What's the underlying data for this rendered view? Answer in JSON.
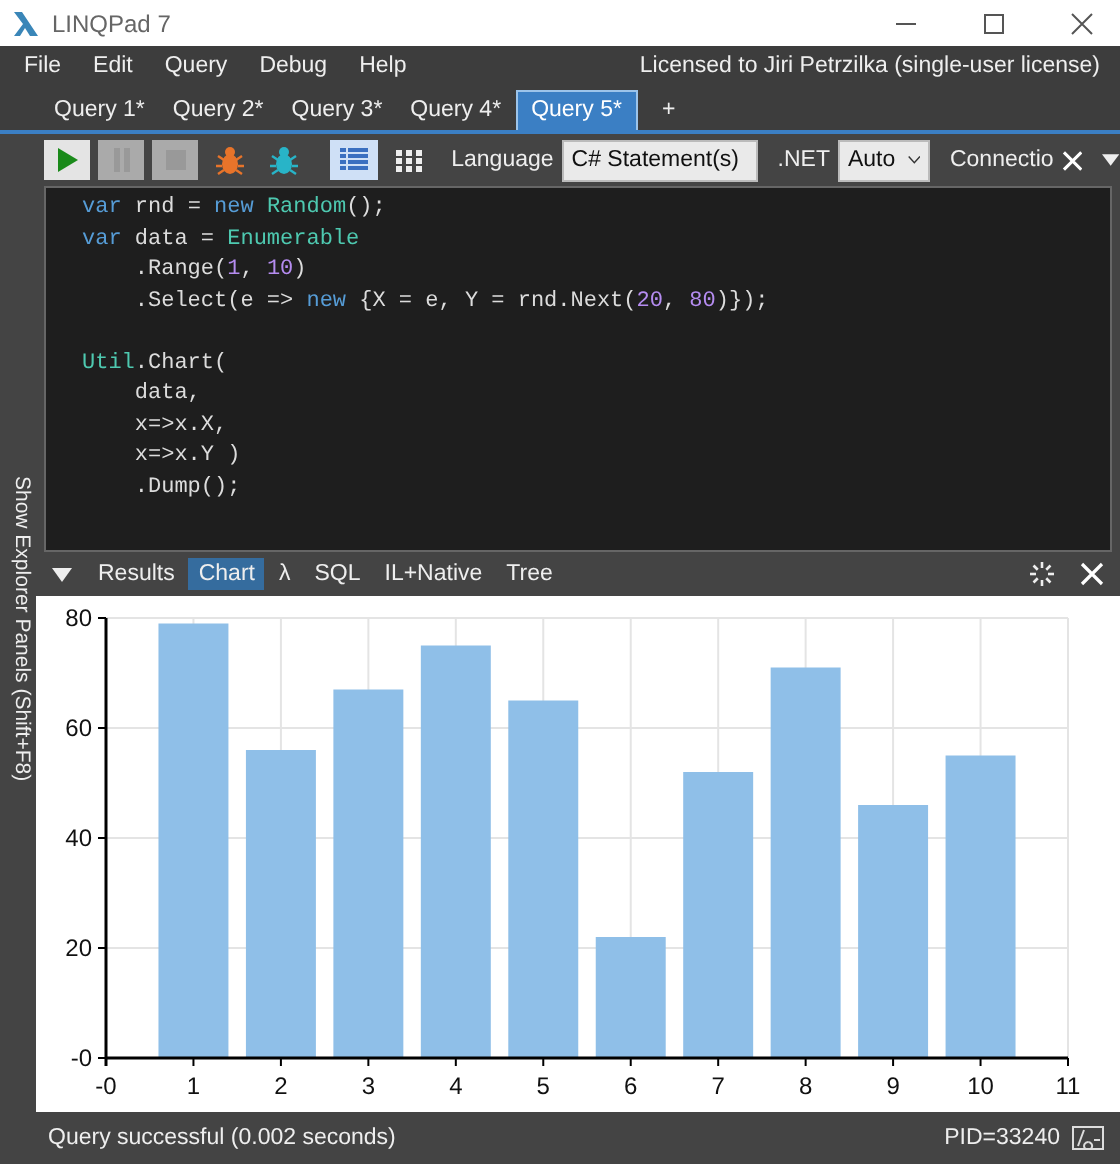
{
  "window": {
    "title": "LINQPad 7"
  },
  "menu": [
    "File",
    "Edit",
    "Query",
    "Debug",
    "Help"
  ],
  "license": "Licensed to Jiri Petrzilka (single-user license)",
  "query_tabs": [
    {
      "label": "Query 1*",
      "selected": false
    },
    {
      "label": "Query 2*",
      "selected": false
    },
    {
      "label": "Query 3*",
      "selected": false
    },
    {
      "label": "Query 4*",
      "selected": false
    },
    {
      "label": "Query 5*",
      "selected": true
    }
  ],
  "new_tab": "+",
  "toolbar": {
    "actions": [
      {
        "kind": "run",
        "disabled": false
      },
      {
        "kind": "pause",
        "disabled": true
      },
      {
        "kind": "stop",
        "disabled": true
      },
      {
        "kind": "bug",
        "disabled": false
      },
      {
        "kind": "bug-step",
        "disabled": false
      }
    ],
    "view_modes": [
      {
        "kind": "rich",
        "selected": true
      },
      {
        "kind": "grid",
        "selected": false
      }
    ],
    "language": {
      "label": "Language",
      "value": "C# Statement(s)"
    },
    "dotnet": {
      "label": ".NET",
      "value": "Auto"
    },
    "connection": {
      "label": "Connectio"
    }
  },
  "explorer_toggle": "Show Explorer Panels  (Shift+F8)",
  "editor": {
    "lines": [
      {
        "tokens": [
          {
            "kind": "kw",
            "text": "var"
          },
          {
            "kind": "plain",
            "text": " rnd = "
          },
          {
            "kind": "kw",
            "text": "new"
          },
          {
            "kind": "type",
            "text": " Random"
          },
          {
            "kind": "plain",
            "text": "();"
          }
        ]
      },
      {
        "tokens": [
          {
            "kind": "kw",
            "text": "var"
          },
          {
            "kind": "plain",
            "text": " data = "
          },
          {
            "kind": "type",
            "text": "Enumerable"
          }
        ]
      },
      {
        "tokens": [
          {
            "kind": "plain",
            "text": "    .Range("
          },
          {
            "kind": "num",
            "text": "1"
          },
          {
            "kind": "plain",
            "text": ", "
          },
          {
            "kind": "num",
            "text": "10"
          },
          {
            "kind": "plain",
            "text": ")"
          }
        ]
      },
      {
        "tokens": [
          {
            "kind": "plain",
            "text": "    .Select(e => "
          },
          {
            "kind": "kw",
            "text": "new"
          },
          {
            "kind": "plain",
            "text": " {X = e, Y = rnd.Next("
          },
          {
            "kind": "num",
            "text": "20"
          },
          {
            "kind": "plain",
            "text": ", "
          },
          {
            "kind": "num",
            "text": "80"
          },
          {
            "kind": "plain",
            "text": ")});"
          }
        ]
      },
      {
        "gap_before": true,
        "tokens": [
          {
            "kind": "type",
            "text": "Util"
          },
          {
            "kind": "plain",
            "text": ".Chart("
          }
        ]
      },
      {
        "tokens": [
          {
            "kind": "plain",
            "text": "    data,"
          }
        ]
      },
      {
        "tokens": [
          {
            "kind": "plain",
            "text": "    x=>x.X,"
          }
        ]
      },
      {
        "tokens": [
          {
            "kind": "plain",
            "text": "    x=>x.Y )"
          }
        ]
      },
      {
        "tokens": [
          {
            "kind": "plain",
            "text": "    .Dump();"
          }
        ]
      }
    ]
  },
  "results_tabs": [
    {
      "label": "Results",
      "selected": false
    },
    {
      "label": "Chart",
      "selected": true
    },
    {
      "label": "λ",
      "selected": false
    },
    {
      "label": "SQL",
      "selected": false
    },
    {
      "label": "IL+Native",
      "selected": false
    },
    {
      "label": "Tree",
      "selected": false
    }
  ],
  "chart": {
    "chart_data": {
      "type": "bar",
      "x": [
        1,
        2,
        3,
        4,
        5,
        6,
        7,
        8,
        9,
        10
      ],
      "grid": true,
      "series": [
        {
          "color": "#8fbfe8",
          "values": [
            79,
            56,
            67,
            75,
            65,
            22,
            52,
            71,
            46,
            55
          ]
        }
      ],
      "xlim": [
        0,
        11
      ],
      "ylim": [
        0,
        80
      ],
      "xticks": [
        {
          "value": 0,
          "label": "-0"
        },
        1,
        2,
        3,
        4,
        5,
        6,
        7,
        8,
        9,
        10,
        11
      ],
      "yticks": [
        {
          "value": 0,
          "label": "-0"
        },
        20,
        40,
        60,
        80
      ]
    }
  },
  "status_bar": {
    "message": "Query successful  (0.002 seconds)",
    "pid": "PID=33240"
  }
}
